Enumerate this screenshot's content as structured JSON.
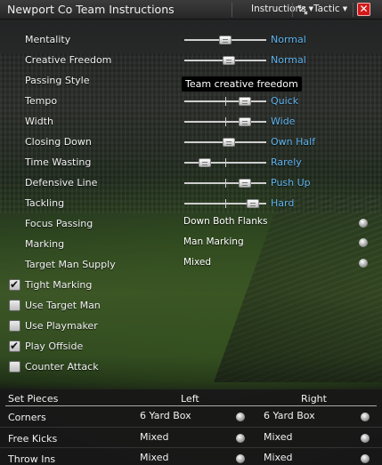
{
  "window": {
    "title": "Newport Co Team Instructions"
  },
  "toolbar": {
    "instructions_label": "Instructions",
    "tactic_label": "Tactic",
    "close_label": "✕"
  },
  "sliders": [
    {
      "label": "Mentality",
      "value": "Normal",
      "level": 0.5
    },
    {
      "label": "Creative Freedom",
      "value": "Normal",
      "level": 0.55
    },
    {
      "label": "Tempo",
      "value": "Quick",
      "level": 0.78
    },
    {
      "label": "Width",
      "value": "Wide",
      "level": 0.78
    },
    {
      "label": "Closing Down",
      "value": "Own Half",
      "level": 0.55
    },
    {
      "label": "Time Wasting",
      "value": "Rarely",
      "level": 0.2
    },
    {
      "label": "Defensive Line",
      "value": "Push Up",
      "level": 0.78
    },
    {
      "label": "Tackling",
      "value": "Hard",
      "level": 0.9
    }
  ],
  "passing_style": {
    "label": "Passing Style",
    "tooltip": "Team creative freedom"
  },
  "dropdowns": [
    {
      "label": "Focus Passing",
      "value": "Down Both Flanks"
    },
    {
      "label": "Marking",
      "value": "Man Marking"
    },
    {
      "label": "Target Man Supply",
      "value": "Mixed"
    }
  ],
  "checkboxes": [
    {
      "label": "Tight Marking",
      "checked": true
    },
    {
      "label": "Use Target Man",
      "checked": false
    },
    {
      "label": "Use Playmaker",
      "checked": false
    },
    {
      "label": "Play Offside",
      "checked": true
    },
    {
      "label": "Counter Attack",
      "checked": false
    }
  ],
  "set_pieces": {
    "headers": {
      "title": "Set Pieces",
      "left": "Left",
      "right": "Right"
    },
    "rows": [
      {
        "label": "Corners",
        "left": "6 Yard Box",
        "right": "6 Yard Box"
      },
      {
        "label": "Free Kicks",
        "left": "Mixed",
        "right": "Mixed"
      },
      {
        "label": "Throw Ins",
        "left": "Mixed",
        "right": "Mixed"
      }
    ]
  },
  "colors": {
    "accent_value": "#5fb4f0",
    "close_button": "#d21a1a"
  }
}
